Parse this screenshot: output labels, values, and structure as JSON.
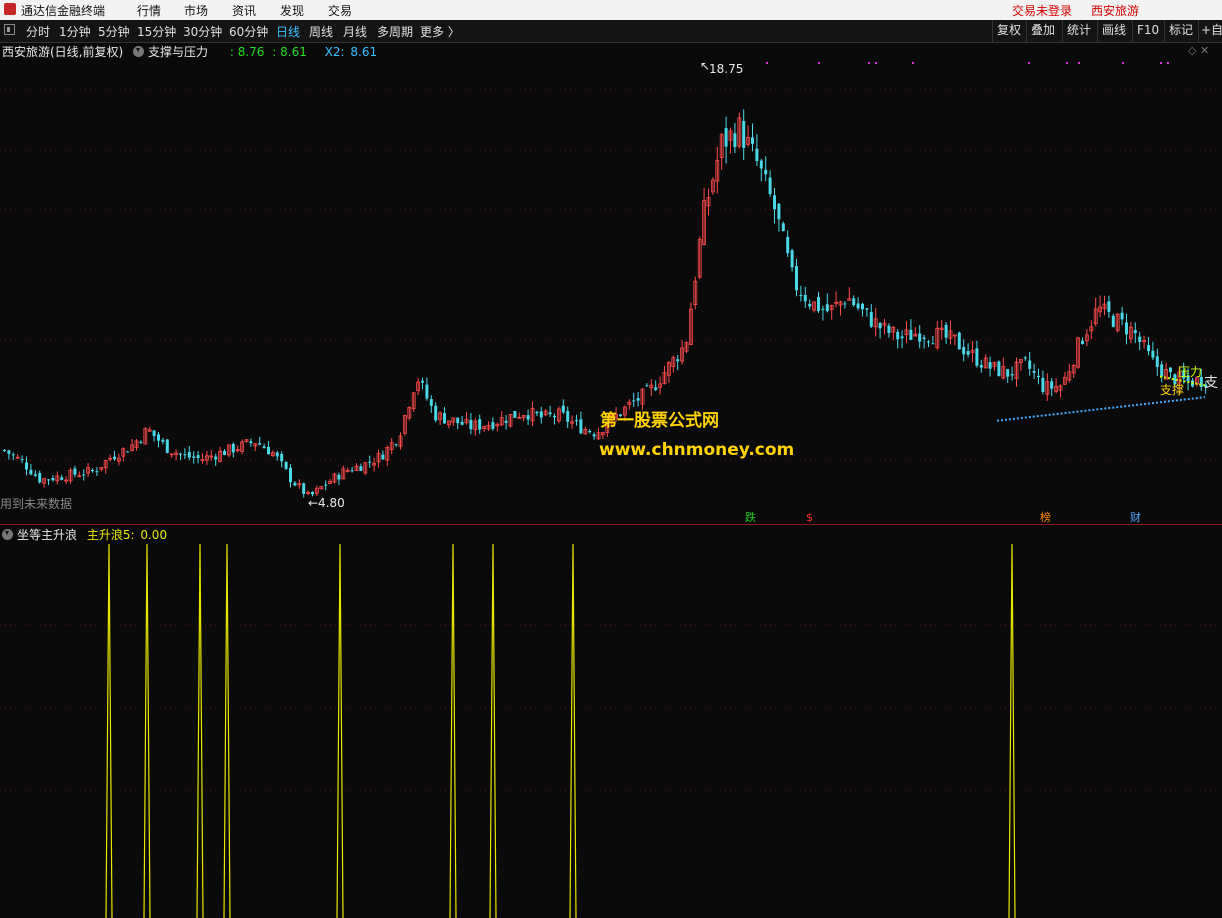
{
  "app": {
    "title": "通达信金融终端",
    "menus": [
      "行情",
      "市场",
      "资讯",
      "发现",
      "交易"
    ],
    "login_status": "交易未登录",
    "stock_name": "西安旅游"
  },
  "periods": [
    {
      "label": "分时"
    },
    {
      "label": "1分钟"
    },
    {
      "label": "5分钟"
    },
    {
      "label": "15分钟"
    },
    {
      "label": "30分钟"
    },
    {
      "label": "60分钟"
    },
    {
      "label": "日线",
      "active": true
    },
    {
      "label": "周线"
    },
    {
      "label": "月线"
    },
    {
      "label": "多周期"
    },
    {
      "label": "更多 〉"
    }
  ],
  "toolbar": [
    "复权",
    "叠加",
    "统计",
    "画线",
    "F10",
    "标记",
    "+自"
  ],
  "main_pane": {
    "title": "西安旅游(日线,前复权)",
    "indicator": "支撑与压力",
    "v1": ": 8.76",
    "v2": ": 8.61",
    "x2_label": "X2:",
    "x2_value": "8.61",
    "high_label": "18.75",
    "low_label": "←4.80",
    "future_label": "用到未来数据",
    "pressure_label": "压力",
    "support_label": "支撑",
    "edge_label": "支"
  },
  "event_markers": [
    {
      "text": "跌",
      "color": "#22cc22"
    },
    {
      "text": "$",
      "color": "#ff3333"
    },
    {
      "text": "榜",
      "color": "#ff8800"
    },
    {
      "text": "财",
      "color": "#55aaff"
    }
  ],
  "watermark": {
    "line1": "第一股票公式网",
    "line2": "www.chnmoney.com"
  },
  "sub_pane": {
    "name": "坐等主升浪",
    "series_label": "主升浪5:",
    "series_value": "0.00"
  },
  "colors": {
    "up": "#ff4a4a",
    "down": "#4ad8e8",
    "pressure": "#ccff00",
    "support": "#44aaff",
    "spike": "#e6e600"
  },
  "chart_data": [
    {
      "type": "candlestick",
      "ylim": [
        4.0,
        19.8
      ],
      "high_label_value": 18.75,
      "low_label_value": 4.8,
      "close_path": [
        6.5,
        6.1,
        5.5,
        5.6,
        5.7,
        5.8,
        6.3,
        6.6,
        7.2,
        6.6,
        6.3,
        6.2,
        6.4,
        6.6,
        6.8,
        6.4,
        5.5,
        4.9,
        5.4,
        5.8,
        6.0,
        6.3,
        7.0,
        9.0,
        7.7,
        7.5,
        7.3,
        7.4,
        7.6,
        7.8,
        7.6,
        7.7,
        7.3,
        7.1,
        7.6,
        8.1,
        8.5,
        9.3,
        10.1,
        14.5,
        16.9,
        17.4,
        16.2,
        14.6,
        12.2,
        11.5,
        11.2,
        11.7,
        11.1,
        10.6,
        10.3,
        10.5,
        10.4,
        10.2,
        9.7,
        9.3,
        9.1,
        9.4,
        8.6,
        8.7,
        10.2,
        11.3,
        10.9,
        10.5,
        9.5,
        9.0,
        8.8,
        8.9
      ],
      "lines": [
        {
          "name": "压力",
          "from": [
            1160,
            9.0
          ],
          "to": [
            1205,
            8.7
          ]
        },
        {
          "name": "支撑",
          "from": [
            997,
            7.5
          ],
          "to": [
            1205,
            8.3
          ]
        }
      ]
    },
    {
      "type": "bar",
      "name": "主升浪5",
      "ylim": [
        0,
        1
      ],
      "spike_x": [
        109,
        147,
        200,
        227,
        340,
        453,
        493,
        573,
        1012
      ]
    }
  ]
}
